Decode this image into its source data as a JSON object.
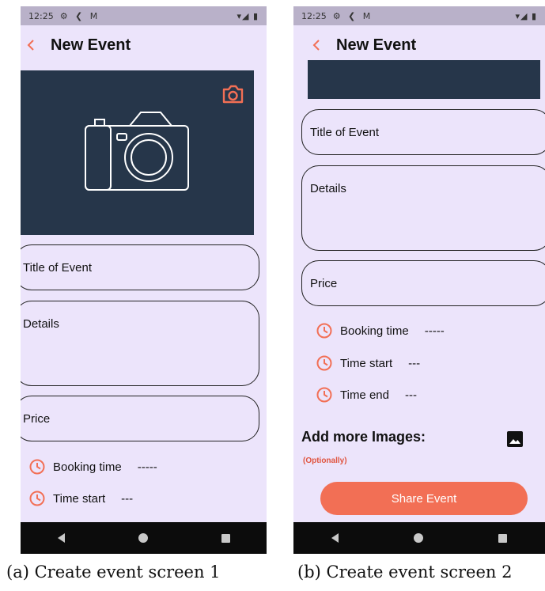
{
  "screen_a": {
    "status": {
      "time": "12:25",
      "icons": "⚙ ❮ M",
      "right": "▾◢ ▮"
    },
    "title": "New Event",
    "fields": {
      "title": "Title of Event",
      "details": "Details",
      "price": "Price"
    },
    "rows": [
      {
        "label": "Booking time",
        "value": "-----"
      },
      {
        "label": "Time start",
        "value": "---"
      }
    ],
    "caption": "(a) Create event screen 1"
  },
  "screen_b": {
    "status": {
      "time": "12:25",
      "icons": "⚙ ❮ M",
      "right": "▾◢ ▮"
    },
    "title": "New Event",
    "fields": {
      "title": "Title of Event",
      "details": "Details",
      "price": "Price"
    },
    "rows": [
      {
        "label": "Booking time",
        "value": "-----"
      },
      {
        "label": "Time start",
        "value": "---"
      },
      {
        "label": "Time end",
        "value": "---"
      }
    ],
    "add_images": "Add more Images:",
    "optional": "(Optionally)",
    "share_button": "Share Event",
    "caption": "(b) Create event screen 2"
  },
  "colors": {
    "accent": "#f26f55",
    "background": "#ece4fb",
    "image_bg": "#26364a",
    "nav_bar": "#0c0c0c"
  },
  "icons": [
    "back-icon",
    "camera-icon",
    "clock-icon",
    "image-icon",
    "nav-back-icon",
    "nav-home-icon",
    "nav-recent-icon"
  ]
}
